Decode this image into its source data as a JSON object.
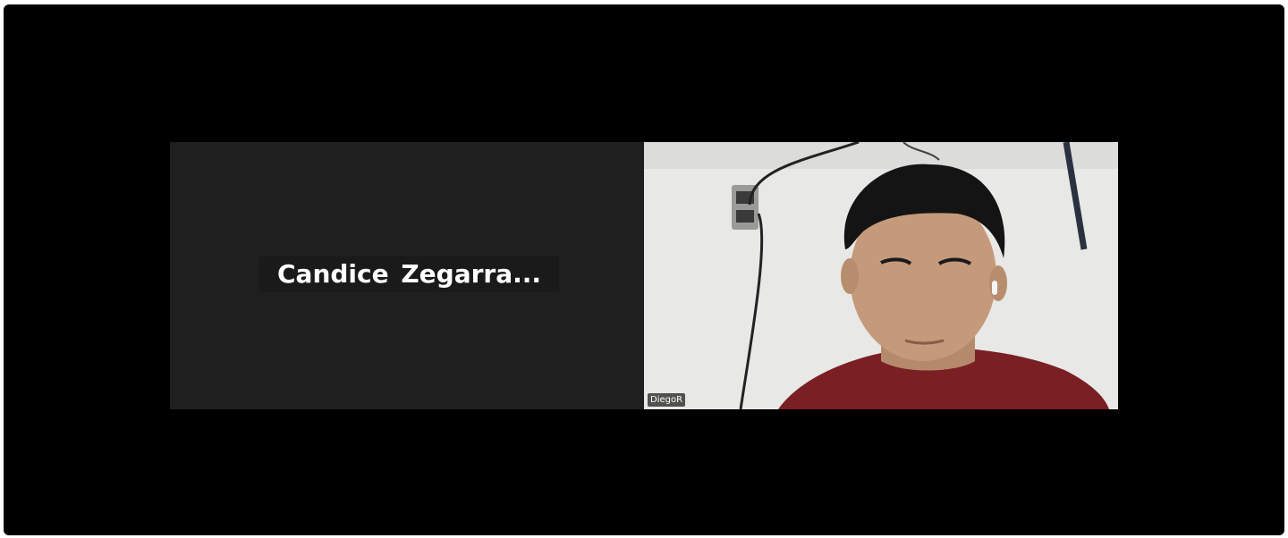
{
  "meeting": {
    "participants": [
      {
        "display_name": "Candice  Zegarra...",
        "video_on": false
      },
      {
        "display_name": "DiegoR",
        "video_on": true
      }
    ]
  },
  "colors": {
    "background": "#000000",
    "tile_off": "#1f1f1f",
    "label_text": "#ffffff"
  }
}
